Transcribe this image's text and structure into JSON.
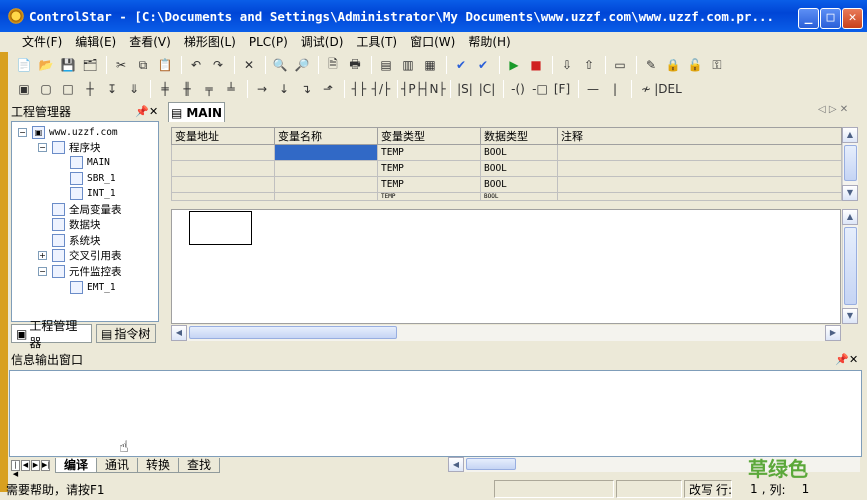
{
  "window": {
    "title": "ControlStar - [C:\\Documents and Settings\\Administrator\\My Documents\\www.uzzf.com\\www.uzzf.com.pr..."
  },
  "menu": [
    "文件(F)",
    "编辑(E)",
    "查看(V)",
    "梯形图(L)",
    "PLC(P)",
    "调试(D)",
    "工具(T)",
    "窗口(W)",
    "帮助(H)"
  ],
  "project_panel": {
    "title": "工程管理器",
    "tree": {
      "root": "www.uzzf.com",
      "program_block": "程序块",
      "main": "MAIN",
      "sbr": "SBR_1",
      "intr": "INT_1",
      "global_vars": "全局变量表",
      "data_block": "数据块",
      "system_block": "系统块",
      "cross_ref": "交叉引用表",
      "monitor": "元件监控表",
      "emt": "EMT_1"
    },
    "tabs": [
      "工程管理器",
      "指令树"
    ]
  },
  "editor": {
    "tab": "MAIN",
    "columns": [
      "变量地址",
      "变量名称",
      "变量类型",
      "数据类型",
      "注释"
    ],
    "rows": [
      {
        "type": "TEMP",
        "dtype": "BOOL"
      },
      {
        "type": "TEMP",
        "dtype": "BOOL"
      },
      {
        "type": "TEMP",
        "dtype": "BOOL"
      },
      {
        "type": "TEMP",
        "dtype": "BOOL"
      }
    ]
  },
  "info": {
    "title": "信息输出窗口",
    "tabs": [
      "编译",
      "通讯",
      "转换",
      "查找"
    ]
  },
  "status": {
    "help": "需要帮助，请按F1",
    "mode": "改写",
    "line_label": "行:",
    "line": "1",
    "col_label": "列:",
    "col": "1"
  },
  "watermark": "草绿色",
  "colors": {
    "titlebar": "#0a5ee8",
    "face": "#ece9d8",
    "selected_cell": "#3169c6"
  }
}
